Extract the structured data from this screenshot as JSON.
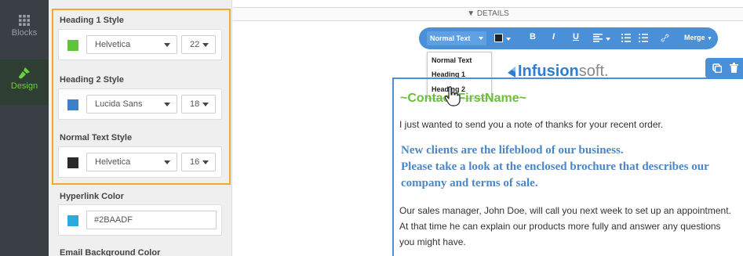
{
  "sidebar_rail": {
    "items": [
      {
        "label": "Blocks",
        "icon": "grid-icon",
        "color": "#9aa0a6"
      },
      {
        "label": "Design",
        "icon": "paint-brush-icon",
        "color": "#6bcf3f"
      }
    ]
  },
  "design_panel": {
    "heading1": {
      "title": "Heading 1 Style",
      "color": "#5ec43a",
      "font": "Helvetica",
      "size": "22"
    },
    "heading2": {
      "title": "Heading 2 Style",
      "color": "#3f7fc7",
      "font": "Lucida Sans",
      "size": "18"
    },
    "normal": {
      "title": "Normal Text Style",
      "color": "#2a2a2a",
      "font": "Helvetica",
      "size": "16"
    },
    "hyperlink": {
      "title": "Hyperlink Color",
      "color": "#2BAADF",
      "value": "#2BAADF"
    },
    "background": {
      "title": "Email Background Color"
    }
  },
  "details": {
    "label": "DETAILS"
  },
  "toolbar": {
    "style_label": "Normal Text",
    "bold": "B",
    "italic": "I",
    "underline": "U",
    "merge": "Merge"
  },
  "style_menu": {
    "items": [
      "Normal Text",
      "Heading 1",
      "Heading 2"
    ]
  },
  "email": {
    "logo_brand": "Infusion",
    "logo_suffix": "soft.",
    "greeting": "~Contact.FirstName~",
    "intro": "I just wanted to send you a note of thanks for your recent order.",
    "heading_lines": [
      "New clients are the lifeblood of our business.",
      "Please take a look at the enclosed brochure that describes our",
      "company and terms of sale."
    ],
    "body_lines": [
      "Our sales manager, John Doe, will call you next week to set up an appointment.",
      "At that time he can explain our products more fully and answer any questions",
      "you might have."
    ]
  }
}
